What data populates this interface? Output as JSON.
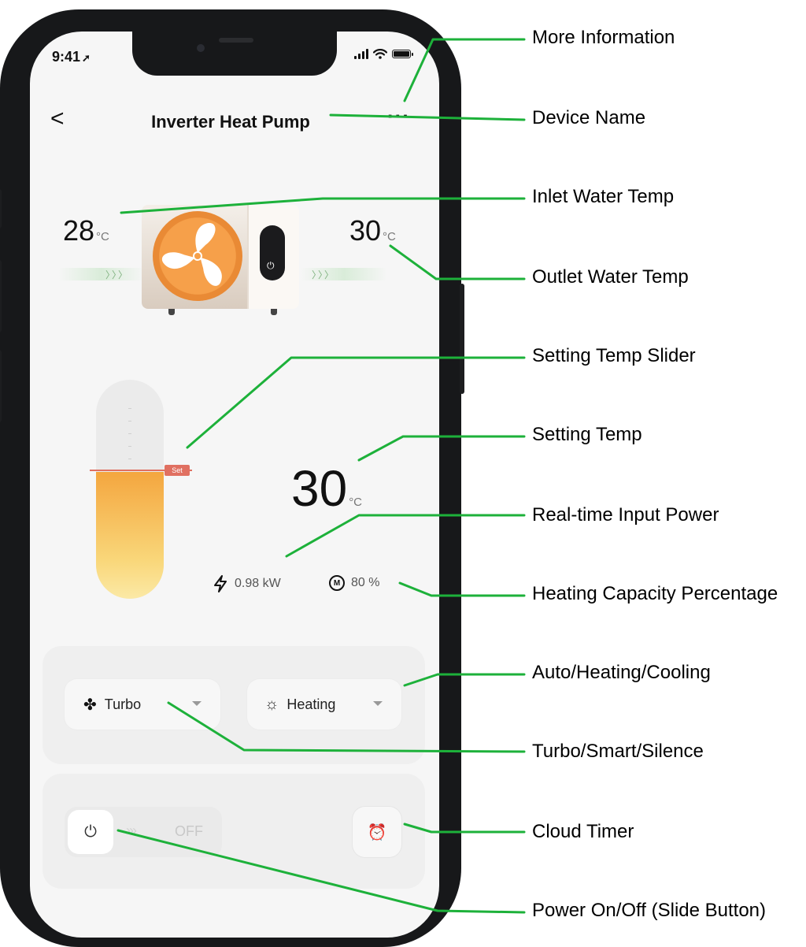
{
  "status_bar": {
    "time": "9:41",
    "arrow": "➚"
  },
  "header": {
    "back_glyph": "<",
    "title": "Inverter Heat Pump",
    "more_glyph": "···"
  },
  "inlet": {
    "value": "28",
    "unit": "°C"
  },
  "outlet": {
    "value": "30",
    "unit": "°C"
  },
  "flow_arrows": "〉〉〉",
  "slider": {
    "set_label": "Set",
    "level_fraction": 0.58
  },
  "setting_temp": {
    "value": "30",
    "unit": "°C"
  },
  "power_info": {
    "icon": "bolt-icon",
    "value": "0.98 kW"
  },
  "capacity_info": {
    "icon": "m-icon",
    "glyph": "M",
    "value": "80 %"
  },
  "mode_controls": {
    "fan_mode": {
      "icon": "fan-icon",
      "glyph": "✤",
      "label": "Turbo"
    },
    "work_mode": {
      "icon": "sun-icon",
      "glyph": "☼",
      "label": "Heating"
    }
  },
  "power_slider": {
    "icon": "power-icon",
    "glyph": "⏻",
    "chevrons": "›››",
    "state_label": "OFF"
  },
  "timer": {
    "icon": "alarm-clock-icon",
    "glyph": "⏰"
  },
  "callouts": [
    "More Information",
    "Device Name",
    "Inlet Water Temp",
    "Outlet Water Temp",
    "Setting Temp Slider",
    "Setting Temp",
    "Real-time Input Power",
    "Heating Capacity Percentage",
    "Auto/Heating/Cooling",
    "Turbo/Smart/Silence",
    "Cloud Timer",
    "Power On/Off (Slide Button)"
  ],
  "colors": {
    "callout_line": "#1db13a",
    "phone_frame": "#17181a",
    "screen_bg": "#f6f6f6",
    "fan_orange": "#f6a04a",
    "set_marker": "#e07061"
  }
}
